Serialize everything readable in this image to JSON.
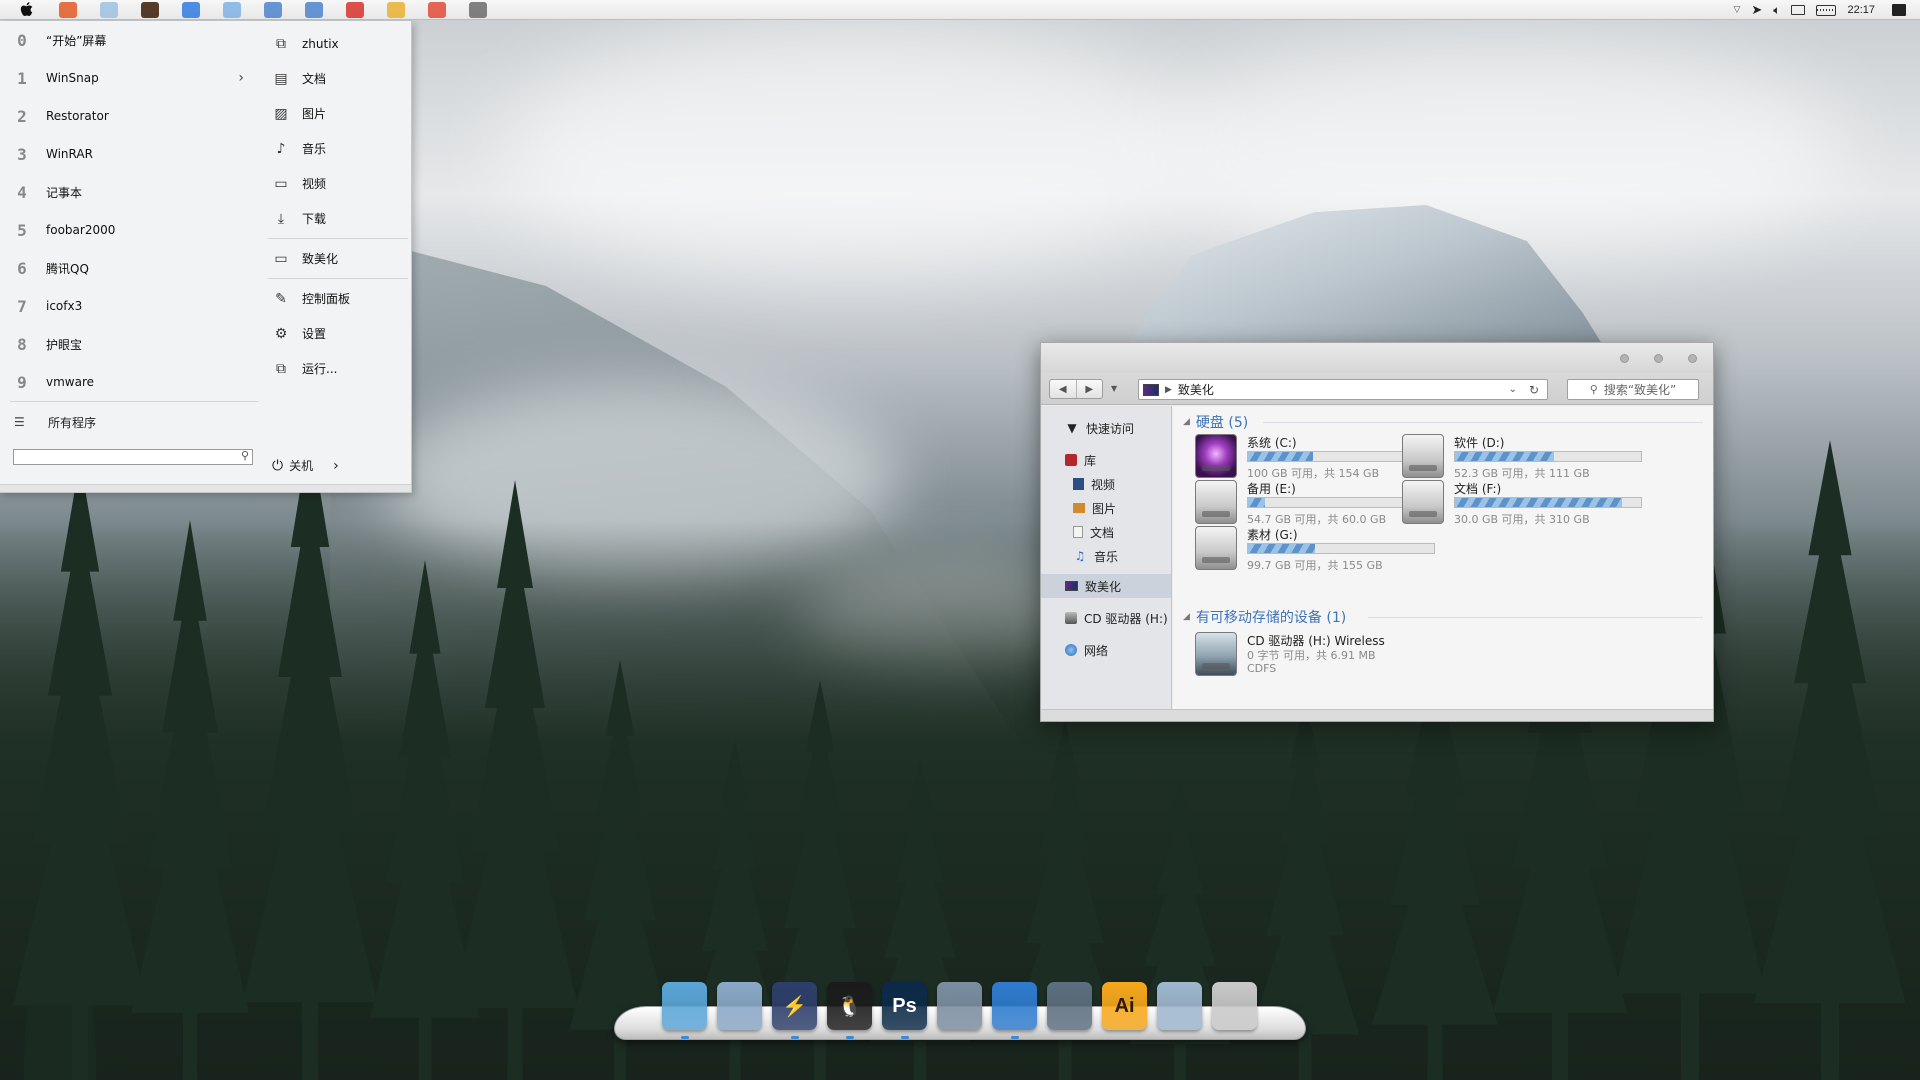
{
  "menubar": {
    "apps": [
      {
        "name": "office-icon",
        "color": "#e35b24"
      },
      {
        "name": "photoshop-icon",
        "color": "#9cc1e4"
      },
      {
        "name": "illustrator-icon",
        "color": "#3b1c05"
      },
      {
        "name": "shield-icon",
        "color": "#2f7be0"
      },
      {
        "name": "outlook-icon",
        "color": "#7fb2e3"
      },
      {
        "name": "notes-icon",
        "color": "#4b84cc"
      },
      {
        "name": "paper-plane-icon",
        "color": "#4b84cc"
      },
      {
        "name": "netease-music-icon",
        "color": "#d8312c"
      },
      {
        "name": "folder-icon",
        "color": "#e6b12f"
      },
      {
        "name": "chrome-icon",
        "color": "#e14b37"
      },
      {
        "name": "tool-icon",
        "color": "#6b6b6b"
      }
    ],
    "clock": "22:17"
  },
  "startmenu": {
    "programs": [
      {
        "glyph": "0",
        "label": "“开始”屏幕"
      },
      {
        "glyph": "1",
        "label": "WinSnap",
        "has_submenu": true
      },
      {
        "glyph": "2",
        "label": "Restorator"
      },
      {
        "glyph": "3",
        "label": "WinRAR"
      },
      {
        "glyph": "4",
        "label": "记事本"
      },
      {
        "glyph": "5",
        "label": "foobar2000"
      },
      {
        "glyph": "6",
        "label": "腾讯QQ"
      },
      {
        "glyph": "7",
        "label": "icofx3"
      },
      {
        "glyph": "8",
        "label": "护眼宝"
      },
      {
        "glyph": "9",
        "label": "vmware"
      }
    ],
    "all_programs": "所有程序",
    "places_group1": [
      {
        "icon": "user-icon",
        "label": "zhutix"
      },
      {
        "icon": "document-icon",
        "label": "文档"
      },
      {
        "icon": "picture-icon",
        "label": "图片"
      },
      {
        "icon": "music-icon",
        "label": "音乐"
      },
      {
        "icon": "video-icon",
        "label": "视频"
      },
      {
        "icon": "download-icon",
        "label": "下载"
      }
    ],
    "places_group2": [
      {
        "icon": "computer-icon",
        "label": "致美化"
      }
    ],
    "places_group3": [
      {
        "icon": "wrench-icon",
        "label": "控制面板"
      },
      {
        "icon": "gear-icon",
        "label": "设置"
      },
      {
        "icon": "run-icon",
        "label": "运行..."
      }
    ],
    "power_label": "关机"
  },
  "explorer": {
    "address": "致美化",
    "search_placeholder": "搜索“致美化”",
    "nav": {
      "quick_access": "快速访问",
      "library": "库",
      "library_items": [
        "视频",
        "图片",
        "文档",
        "音乐"
      ],
      "this_pc": "致美化",
      "cd_drive": "CD 驱动器 (H:)",
      "network": "网络"
    },
    "groups": {
      "hard_disks": "硬盘 (5)",
      "removable": "有可移动存储的设备 (1)"
    },
    "drives": [
      {
        "name": "系统 (C:)",
        "info": "100 GB 可用，共 154 GB",
        "used_fraction": 0.35,
        "icon": "system-drive-icon"
      },
      {
        "name": "软件 (D:)",
        "info": "52.3 GB 可用，共 111 GB",
        "used_fraction": 0.53,
        "icon": "hard-drive-icon"
      },
      {
        "name": "备用 (E:)",
        "info": "54.7 GB 可用，共 60.0 GB",
        "used_fraction": 0.09,
        "icon": "hard-drive-icon"
      },
      {
        "name": "文档 (F:)",
        "info": "30.0 GB 可用，共 310 GB",
        "used_fraction": 0.9,
        "icon": "hard-drive-icon"
      },
      {
        "name": "素材 (G:)",
        "info": "99.7 GB 可用，共 155 GB",
        "used_fraction": 0.36,
        "icon": "hard-drive-icon"
      }
    ],
    "cd": {
      "name": "CD 驱动器 (H:) Wireless",
      "info": "0 字节 可用，共 6.91 MB",
      "fs": "CDFS"
    }
  },
  "dock": {
    "items": [
      {
        "name": "finder-monitor-icon",
        "label": "",
        "color": "#5aa6d8",
        "running": true
      },
      {
        "name": "design-tools-icon",
        "label": "",
        "color": "#8aa8c8",
        "running": false
      },
      {
        "name": "thunder-icon",
        "label": "⚡",
        "color": "#2d3e6b",
        "running": true
      },
      {
        "name": "qq-penguin-icon",
        "label": "🐧",
        "color": "#1b1b1b",
        "running": true
      },
      {
        "name": "photoshop-dock-icon",
        "label": "Ps",
        "color": "#0c2a48",
        "running": true
      },
      {
        "name": "terminal-helmet-icon",
        "label": "",
        "color": "#7b8ea1",
        "running": false
      },
      {
        "name": "safari-icon",
        "label": "",
        "color": "#2f7ccf",
        "running": true
      },
      {
        "name": "movie-clapper-icon",
        "label": "",
        "color": "#5d6f80",
        "running": false
      },
      {
        "name": "illustrator-dock-icon",
        "label": "Ai",
        "color": "#f7a81b",
        "running": false
      },
      {
        "name": "box-icon",
        "label": "",
        "color": "#9fb7cf",
        "running": false
      },
      {
        "name": "pencil-cup-icon",
        "label": "",
        "color": "#c9c9c9",
        "running": false
      }
    ]
  }
}
